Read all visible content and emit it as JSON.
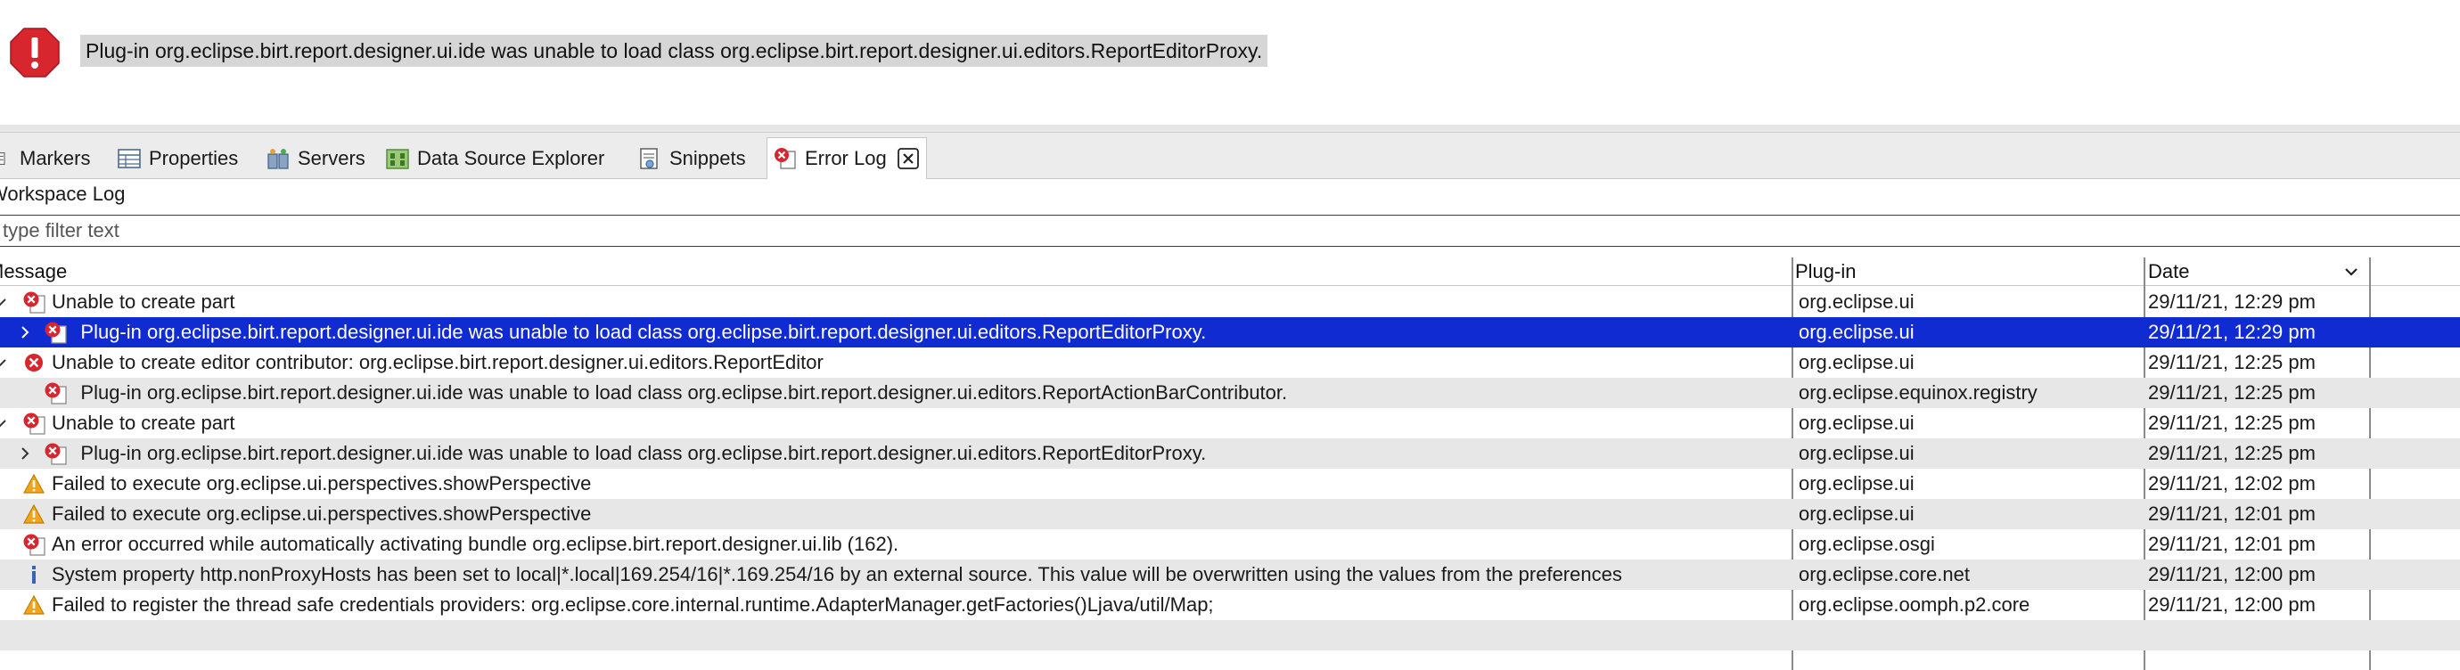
{
  "banner": {
    "message": "Plug-in org.eclipse.birt.report.designer.ui.ide was unable to load class org.eclipse.birt.report.designer.ui.editors.ReportEditorProxy.",
    "icon": "error-stop-icon",
    "color": "#d8262f"
  },
  "tabs": [
    {
      "label": "Markers",
      "icon": "markers-icon"
    },
    {
      "label": "Properties",
      "icon": "properties-icon"
    },
    {
      "label": "Servers",
      "icon": "servers-icon"
    },
    {
      "label": "Data Source Explorer",
      "icon": "datasource-icon"
    },
    {
      "label": "Snippets",
      "icon": "snippets-icon"
    },
    {
      "label": "Error Log",
      "icon": "error-log-icon",
      "active": true
    }
  ],
  "log": {
    "title": "Workspace Log",
    "filter_placeholder": "type filter text",
    "columns": {
      "message": "Message",
      "plugin": "Plug-in",
      "date": "Date"
    },
    "selection_color": "#0f2bd1",
    "rows": [
      {
        "message": "Unable to create part",
        "plugin": "org.eclipse.ui",
        "date": "29/11/21, 12:29 pm",
        "level": 0,
        "twisty": "expanded",
        "icon": "error-stack-icon"
      },
      {
        "message": "Plug-in org.eclipse.birt.report.designer.ui.ide was unable to load class org.eclipse.birt.report.designer.ui.editors.ReportEditorProxy.",
        "plugin": "org.eclipse.ui",
        "date": "29/11/21, 12:29 pm",
        "level": 1,
        "twisty": "collapsed",
        "icon": "error-stack-icon",
        "selected": true
      },
      {
        "message": "Unable to create editor contributor: org.eclipse.birt.report.designer.ui.editors.ReportEditor",
        "plugin": "org.eclipse.ui",
        "date": "29/11/21, 12:25 pm",
        "level": 0,
        "twisty": "expanded",
        "icon": "error-icon"
      },
      {
        "message": "Plug-in org.eclipse.birt.report.designer.ui.ide was unable to load class org.eclipse.birt.report.designer.ui.editors.ReportActionBarContributor.",
        "plugin": "org.eclipse.equinox.registry",
        "date": "29/11/21, 12:25 pm",
        "level": 1,
        "twisty": "none",
        "icon": "error-stack-icon"
      },
      {
        "message": "Unable to create part",
        "plugin": "org.eclipse.ui",
        "date": "29/11/21, 12:25 pm",
        "level": 0,
        "twisty": "expanded",
        "icon": "error-stack-icon"
      },
      {
        "message": "Plug-in org.eclipse.birt.report.designer.ui.ide was unable to load class org.eclipse.birt.report.designer.ui.editors.ReportEditorProxy.",
        "plugin": "org.eclipse.ui",
        "date": "29/11/21, 12:25 pm",
        "level": 1,
        "twisty": "collapsed",
        "icon": "error-stack-icon"
      },
      {
        "message": "Failed to execute org.eclipse.ui.perspectives.showPerspective",
        "plugin": "org.eclipse.ui",
        "date": "29/11/21, 12:02 pm",
        "level": 0,
        "twisty": "none",
        "icon": "warning-icon"
      },
      {
        "message": "Failed to execute org.eclipse.ui.perspectives.showPerspective",
        "plugin": "org.eclipse.ui",
        "date": "29/11/21, 12:01 pm",
        "level": 0,
        "twisty": "none",
        "icon": "warning-icon"
      },
      {
        "message": "An error occurred while automatically activating bundle org.eclipse.birt.report.designer.ui.lib (162).",
        "plugin": "org.eclipse.osgi",
        "date": "29/11/21, 12:01 pm",
        "level": 0,
        "twisty": "none",
        "icon": "error-stack-icon"
      },
      {
        "message": "System property http.nonProxyHosts has been set to local|*.local|169.254/16|*.169.254/16 by an external source. This value will be overwritten using the values from the preferences",
        "plugin": "org.eclipse.core.net",
        "date": "29/11/21, 12:00 pm",
        "level": 0,
        "twisty": "none",
        "icon": "info-icon"
      },
      {
        "message": "Failed to register the thread safe credentials providers: org.eclipse.core.internal.runtime.AdapterManager.getFactories()Ljava/util/Map;",
        "plugin": "org.eclipse.oomph.p2.core",
        "date": "29/11/21, 12:00 pm",
        "level": 0,
        "twisty": "none",
        "icon": "warning-icon"
      },
      {
        "message": "",
        "plugin": "",
        "date": "",
        "level": 0,
        "twisty": "none",
        "icon": ""
      }
    ]
  }
}
